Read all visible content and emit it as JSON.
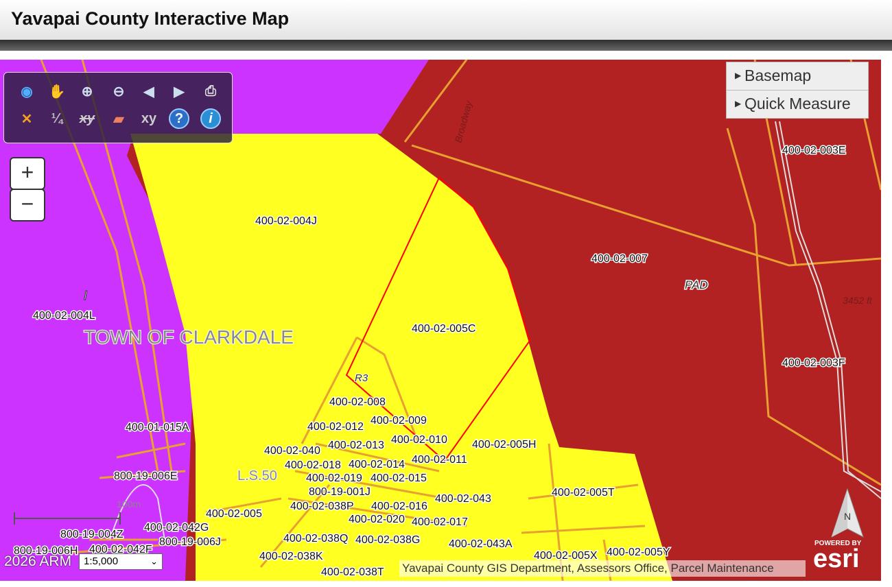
{
  "app": {
    "title": "Yavapai County Interactive Map"
  },
  "toolbar": {
    "tools": [
      {
        "name": "globe-icon",
        "glyph": "◉"
      },
      {
        "name": "pan-hand-icon",
        "glyph": "✋"
      },
      {
        "name": "zoom-in-icon",
        "glyph": "⊕"
      },
      {
        "name": "zoom-out-icon",
        "glyph": "⊖"
      },
      {
        "name": "previous-extent-icon",
        "glyph": "◀"
      },
      {
        "name": "next-extent-icon",
        "glyph": "▶"
      },
      {
        "name": "print-icon",
        "glyph": "⎙"
      },
      {
        "name": "measure-icon",
        "glyph": "✕"
      },
      {
        "name": "fraction-icon",
        "glyph": "¼"
      },
      {
        "name": "xy-strike-icon",
        "glyph": "xy"
      },
      {
        "name": "eraser-icon",
        "glyph": "▰"
      },
      {
        "name": "xy-icon",
        "glyph": "xy"
      },
      {
        "name": "help-icon",
        "glyph": "?"
      },
      {
        "name": "info-icon",
        "glyph": "i"
      }
    ]
  },
  "zoom": {
    "in_label": "+",
    "out_label": "−"
  },
  "menu": {
    "basemap": "Basemap",
    "quick_measure": "Quick Measure"
  },
  "map_labels": {
    "p004J": "400-02-004J",
    "p004L": "400-02-004L",
    "clarkdale": "TOWN OF CLARKDALE",
    "i": "I",
    "p005C": "400-02-005C",
    "r3": "R3",
    "p007": "400-02-007",
    "pad": "PAD",
    "elev": "3452 ft",
    "p003E": "400-02-003E",
    "p003F": "400-02-003F",
    "broadway": "Broadway",
    "p008": "400-02-008",
    "p009": "400-02-009",
    "p012": "400-02-012",
    "p010": "400-02-010",
    "p040": "400-02-040",
    "p013": "400-02-013",
    "p005H": "400-02-005H",
    "p018": "400-02-018",
    "p014": "400-02-014",
    "p011": "400-02-011",
    "ls": "L.S.50",
    "p019": "400-02-019",
    "p015": "400-02-015",
    "p015A": "400-01-015A",
    "p006E": "800-19-006E",
    "p001J": "800-19-001J",
    "p038P": "400-02-038P",
    "p016": "400-02-016",
    "p043": "400-02-043",
    "p005T": "400-02-005T",
    "p005": "400-02-005",
    "p020": "400-02-020",
    "p017": "400-02-017",
    "p042G": "400-02-042G",
    "p004Z": "800-19-004Z",
    "p006J": "800-19-006J",
    "p038Q": "400-02-038Q",
    "p038G": "400-02-038G",
    "p043A": "400-02-043A",
    "p006H": "800-19-006H",
    "p042F": "400-02-042F",
    "p038K": "400-02-038K",
    "p005X": "400-02-005X",
    "p005Y": "400-02-005Y",
    "p038T": "400-02-038T"
  },
  "scalebar": {
    "label": "100m"
  },
  "footer": {
    "date": "2026 ARM",
    "scale_value": "1:5,000",
    "attribution": "Yavapai County GIS Department, Assessors Office, Parcel Maintenance",
    "north": "N",
    "powered_by": "POWERED BY",
    "esri": "esri"
  },
  "colors": {
    "residential": "#ffff22",
    "industrial": "#cc33ff",
    "pad": "#b22222",
    "parcel_line": "#e8a030",
    "selection": "#ff0000"
  }
}
